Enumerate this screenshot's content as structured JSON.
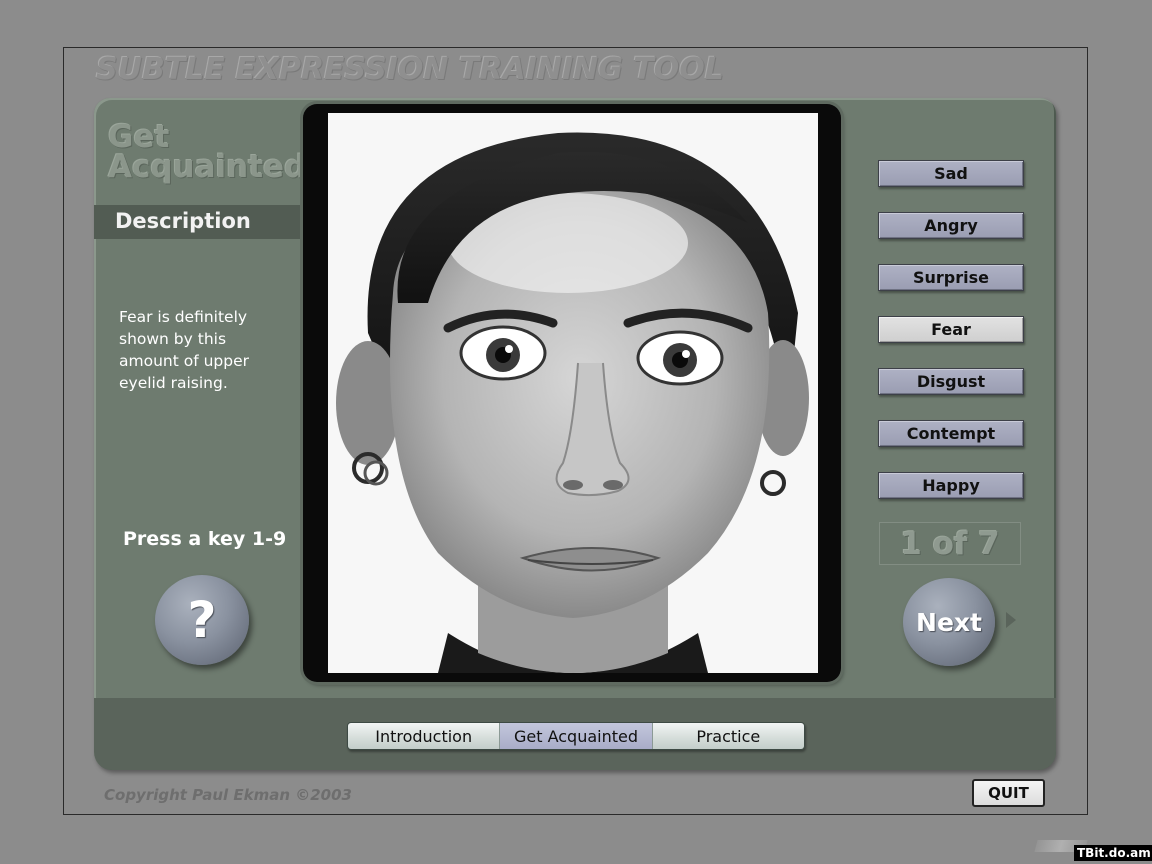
{
  "app": {
    "title": "SUBTLE EXPRESSION TRAINING TOOL",
    "copyright": "Copyright Paul Ekman ©2003",
    "quit_label": "QUIT",
    "watermark": "TBit.do.am"
  },
  "left_panel": {
    "section_heading": "Get Acquainted",
    "description_title": "Description",
    "description_text": "Fear is definitely shown by this amount of upper eyelid raising.",
    "instruction": "Press a key 1-9",
    "help_label": "?"
  },
  "emotions": [
    {
      "label": "Sad",
      "selected": false
    },
    {
      "label": "Angry",
      "selected": false
    },
    {
      "label": "Surprise",
      "selected": false
    },
    {
      "label": "Fear",
      "selected": true
    },
    {
      "label": "Disgust",
      "selected": false
    },
    {
      "label": "Contempt",
      "selected": false
    },
    {
      "label": "Happy",
      "selected": false
    }
  ],
  "counter": "1 of 7",
  "next_label": "Next",
  "tabs": [
    {
      "label": "Introduction",
      "active": false
    },
    {
      "label": "Get Acquainted",
      "active": true
    },
    {
      "label": "Practice",
      "active": false
    }
  ],
  "colors": {
    "panel": "#6e7b6f",
    "button_face": "#9a9db2",
    "selected_button": "#d8d8d8",
    "active_tab": "#a9adc8"
  }
}
